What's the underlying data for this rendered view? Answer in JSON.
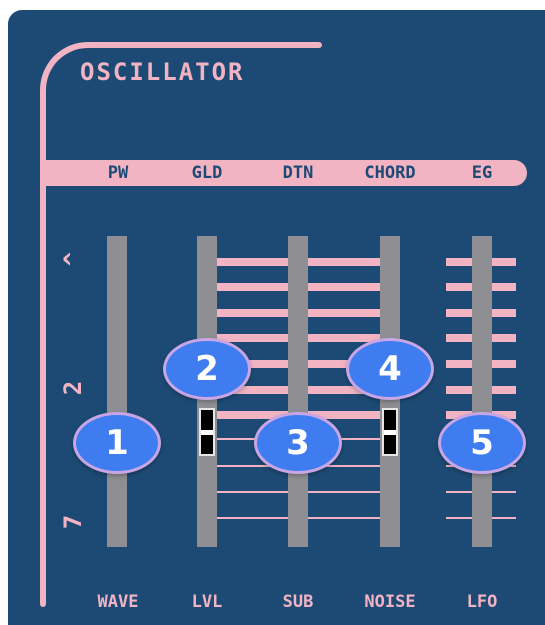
{
  "section": {
    "title": "OSCILLATOR"
  },
  "top_labels": [
    "PW",
    "GLD",
    "DTN",
    "CHORD",
    "EG"
  ],
  "bottom_labels": [
    "WAVE",
    "LVL",
    "SUB",
    "NOISE",
    "LFO"
  ],
  "scale_marks": {
    "top": "^",
    "middle": "2",
    "bottom": "7"
  },
  "markers": [
    "1",
    "2",
    "3",
    "4",
    "5"
  ],
  "colors": {
    "panel": "#1d4a74",
    "accent_pink": "#f2b4c3",
    "track_gray": "#8f8f93",
    "marker_blue": "#3f7cf0",
    "marker_outline": "#c8a6e6"
  }
}
